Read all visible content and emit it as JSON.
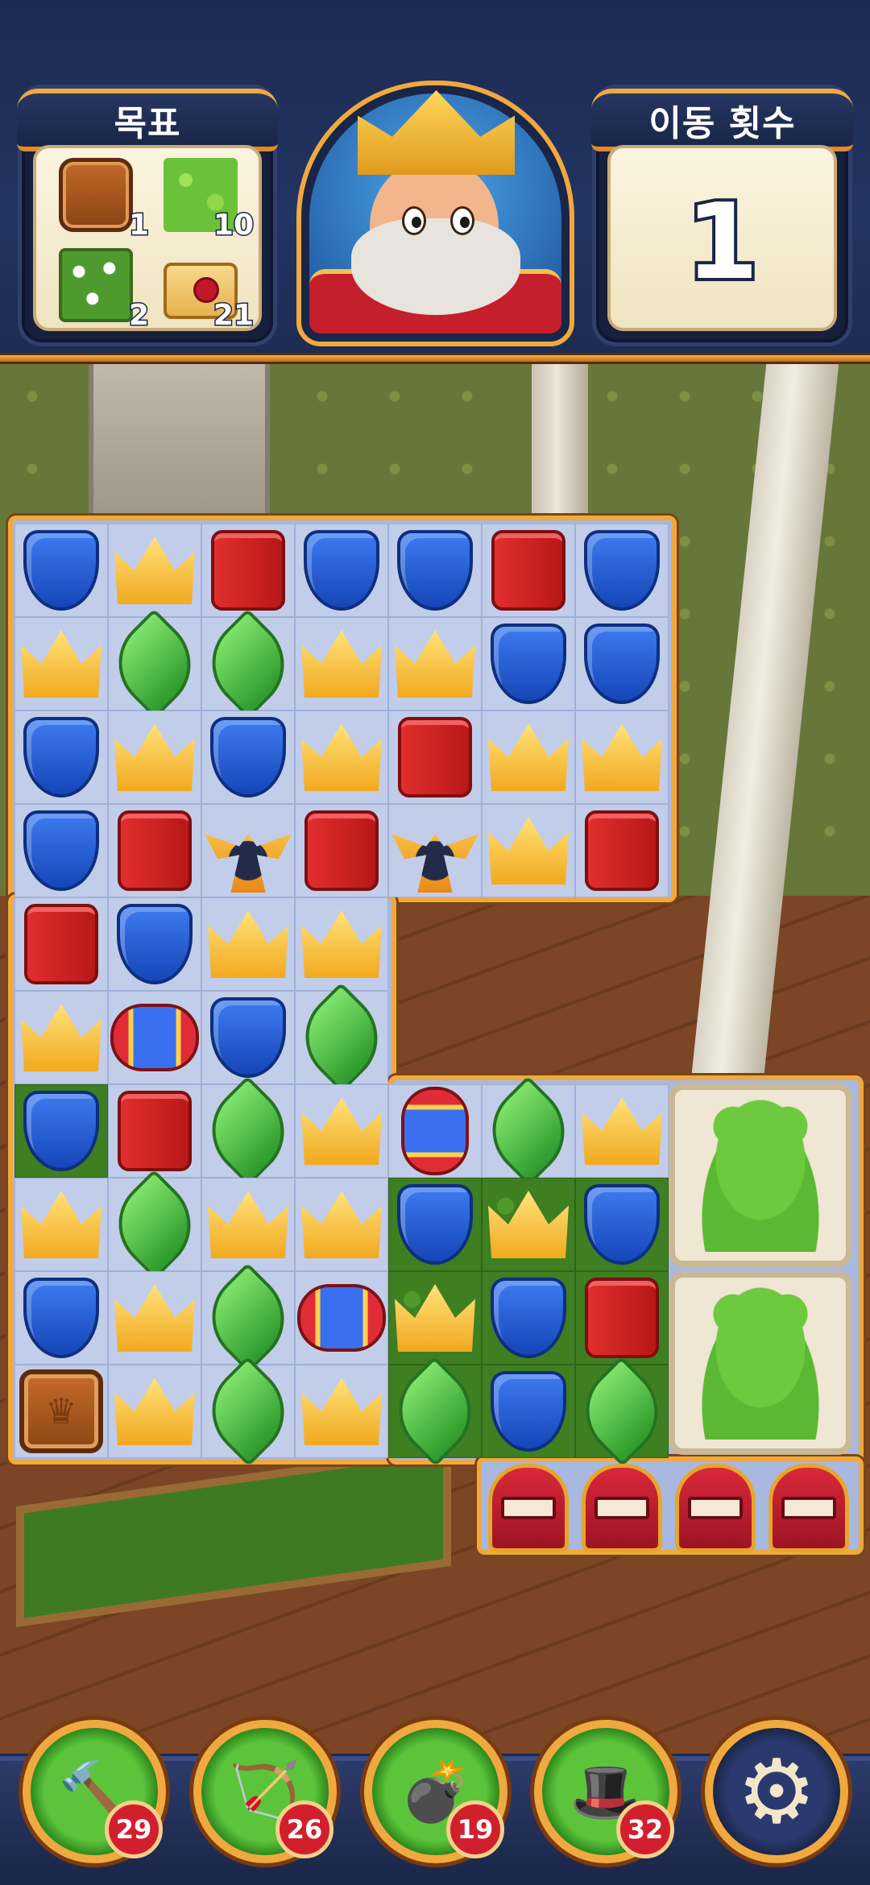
{
  "header": {
    "goals_title": "목표",
    "moves_title": "이동 횟수",
    "moves_left": "1",
    "goals": [
      {
        "icon": "crate-icon",
        "count": "1"
      },
      {
        "icon": "grass-icon",
        "count": "10"
      },
      {
        "icon": "flower-bush-icon",
        "count": "2"
      },
      {
        "icon": "letter-icon",
        "count": "21"
      }
    ],
    "portrait": "king-portrait"
  },
  "board": {
    "rows": [
      [
        "shield",
        "crown",
        "book",
        "shield",
        "shield",
        "book",
        "shield"
      ],
      [
        "crown",
        "leaf",
        "leaf",
        "crown",
        "crown",
        "shield",
        "shield"
      ],
      [
        "shield",
        "crown",
        "shield",
        "crown",
        "book",
        "crown",
        "crown"
      ],
      [
        "shield",
        "book",
        "propeller",
        "book",
        "propeller",
        "crown",
        "book"
      ],
      [
        "book",
        "shield",
        "crown",
        "crown"
      ],
      [
        "crown",
        "rocket-h",
        "shield",
        "leaf"
      ],
      [
        "shield",
        "book",
        "leaf",
        "crown",
        "rocket-v",
        "leaf",
        "crown"
      ],
      [
        "crown",
        "leaf",
        "crown",
        "crown",
        "shield",
        "crown",
        "shield"
      ],
      [
        "shield",
        "crown",
        "leaf",
        "rocket-h",
        "crown",
        "shield",
        "book"
      ],
      [
        "crate",
        "crown",
        "leaf",
        "crown",
        "leaf",
        "shield",
        "leaf"
      ]
    ],
    "obstacles": [
      "topiary-bear-icon",
      "topiary-bear-icon",
      "mailbox-icon",
      "mailbox-icon",
      "mailbox-icon",
      "mailbox-icon"
    ]
  },
  "boosters": [
    {
      "name": "hammer-icon",
      "glyph": "🔨",
      "count": "29"
    },
    {
      "name": "arrow-icon",
      "glyph": "🏹",
      "count": "26"
    },
    {
      "name": "cannon-icon",
      "glyph": "💣",
      "count": "19"
    },
    {
      "name": "jester-hat-icon",
      "glyph": "🎩",
      "count": "32"
    }
  ],
  "settings_icon": "gear-icon"
}
